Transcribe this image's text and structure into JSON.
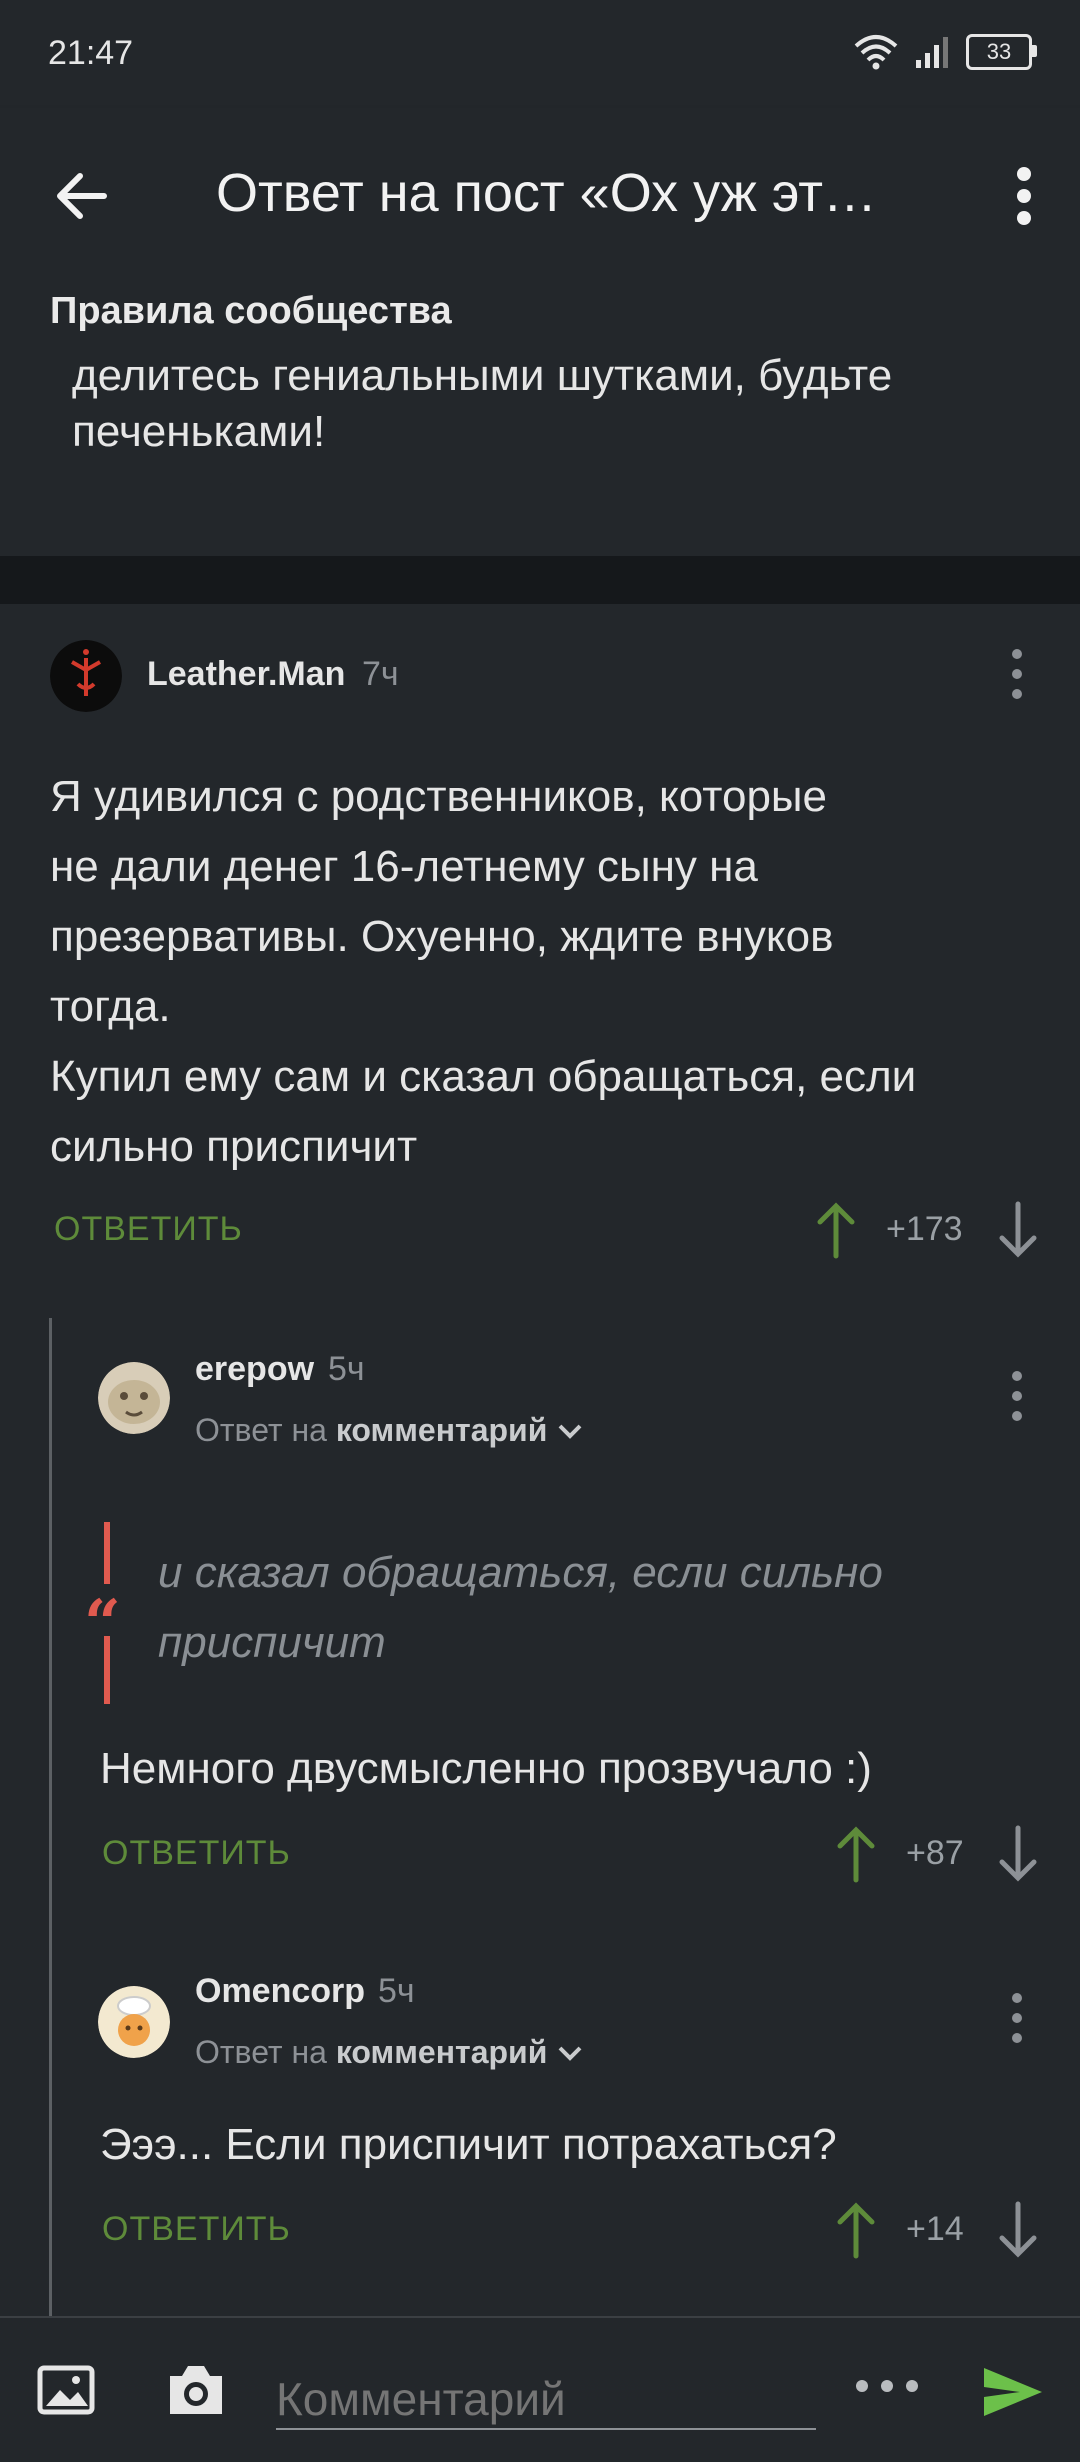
{
  "status_bar": {
    "time": "21:47",
    "battery": "33"
  },
  "app_bar": {
    "title": "Ответ на пост «Ох уж эт…"
  },
  "rules": {
    "heading": "Правила сообщества",
    "text": "делитесь гениальными шутками, будьте печеньками!"
  },
  "comments": [
    {
      "author": "Leather.Man",
      "time": "7ч",
      "lines": [
        "Я удивился с родственников, которые",
        "не дали денег 16-летнему сыну на",
        "презервативы. Охуенно, ждите внуков",
        "тогда.",
        "Купил ему сам и сказал обращаться, если",
        "сильно приспичит"
      ],
      "reply_label": "ОТВЕТИТЬ",
      "rating": "+173"
    },
    {
      "author": "erepow",
      "time": "5ч",
      "reply_prefix": "Ответ на",
      "reply_target": "комментарий",
      "quote_lines": [
        "и сказал обращаться, если сильно",
        "приспичит"
      ],
      "text": "Немного двусмысленно прозвучало :)",
      "reply_label": "ОТВЕТИТЬ",
      "rating": "+87"
    },
    {
      "author": "Omencorp",
      "time": "5ч",
      "reply_prefix": "Ответ на",
      "reply_target": "комментарий",
      "text": "Эээ... Если приспичит потрахаться?",
      "reply_label": "ОТВЕТИТЬ",
      "rating": "+14"
    }
  ],
  "bottom_bar": {
    "placeholder": "Комментарий"
  },
  "colors": {
    "accent_green": "#5e8b3a",
    "send_green": "#6cc04a",
    "quote_red": "#e05a4f",
    "background": "#23272b"
  },
  "icons": [
    "wifi-icon",
    "signal-icon",
    "battery-icon",
    "back-arrow-icon",
    "more-vert-icon",
    "upvote-icon",
    "downvote-icon",
    "chevron-down-icon",
    "image-icon",
    "camera-icon",
    "more-horiz-icon",
    "send-icon"
  ]
}
